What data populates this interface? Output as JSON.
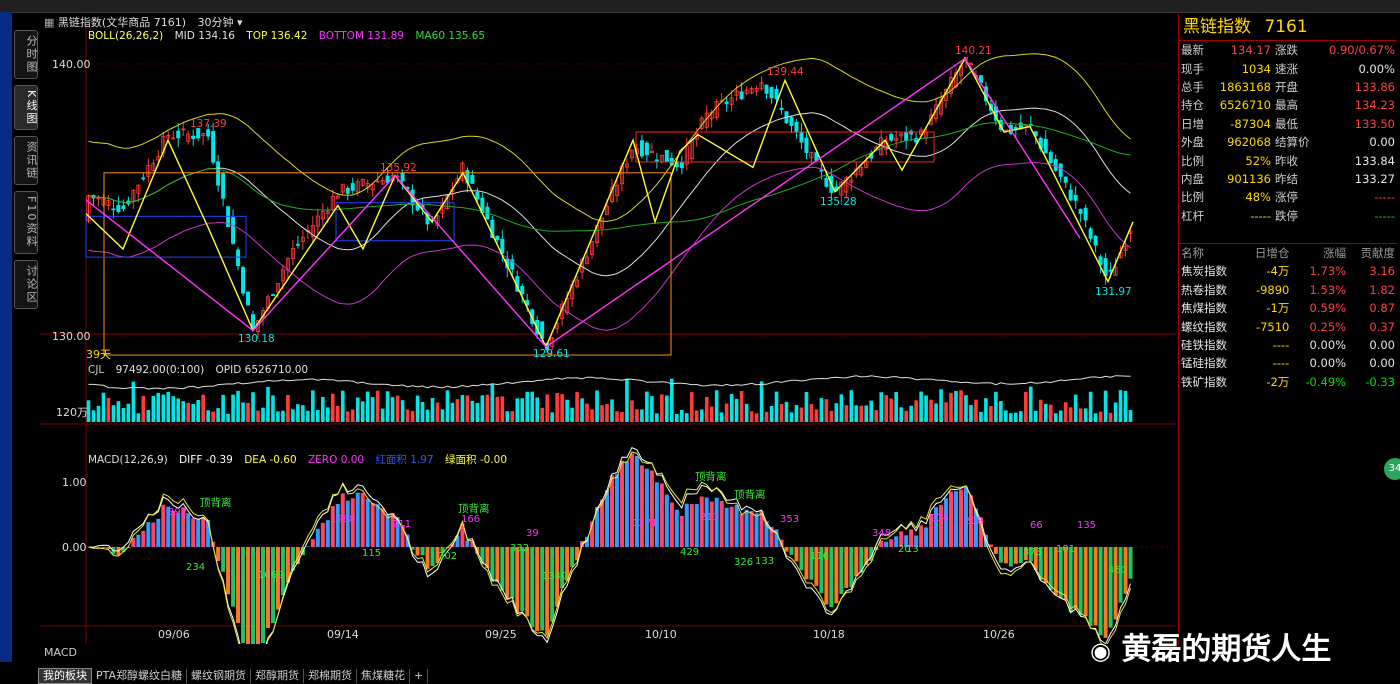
{
  "left_tabs": [
    "分时图",
    "K线图",
    "资讯链",
    "F10资料",
    "讨论区"
  ],
  "header": {
    "title": "黑链指数(文华商品 7161)",
    "period": "30分钟"
  },
  "boll": {
    "name": "BOLL(26,26,2)",
    "mid": "MID 134.16",
    "top": "TOP 136.42",
    "bottom": "BOTTOM 131.89",
    "ma60": "MA60 135.65"
  },
  "price_axis": [
    "140.00",
    "130.00"
  ],
  "days_label": "39天",
  "cjl": {
    "name": "CJL",
    "value": "97492.00(0:100)",
    "opid": "OPID 6526710.00",
    "axis": "120万"
  },
  "macd": {
    "name": "MACD(12,26,9)",
    "diff": "DIFF -0.39",
    "dea": "DEA -0.60",
    "zero": "ZERO 0.00",
    "red_area": "红面积 1.97",
    "green_area": "绿面积 -0.00",
    "axis": [
      "1.00",
      "0.00"
    ]
  },
  "dates": [
    "09/06",
    "09/14",
    "09/25",
    "10/10",
    "10/18",
    "10/26"
  ],
  "price_labels": [
    "137.39",
    "135.92",
    "139.44",
    "140.21",
    "130.18",
    "129.61",
    "135.28",
    "131.97"
  ],
  "macd_labels": [
    "392",
    "1968",
    "211",
    "166",
    "39",
    "1271",
    "211",
    "353",
    "348",
    "274",
    "208",
    "66",
    "135",
    "234",
    "1069",
    "115",
    "302",
    "332",
    "1340",
    "429",
    "326",
    "133",
    "116",
    "20",
    "13",
    "373",
    "101",
    "460"
  ],
  "divergence_labels": [
    "顶背离",
    "顶背离",
    "顶背离",
    "顶背离"
  ],
  "quote": {
    "title_name": "黑链指数",
    "title_code": "7161",
    "rows": [
      [
        "最新",
        "134.17",
        "r",
        "涨跌",
        "0.90/0.67%",
        "r"
      ],
      [
        "现手",
        "1034",
        "y",
        "速涨",
        "0.00%",
        "w"
      ],
      [
        "总手",
        "1863168",
        "y",
        "开盘",
        "133.86",
        "r"
      ],
      [
        "持仓",
        "6526710",
        "y",
        "最高",
        "134.23",
        "r"
      ],
      [
        "日增",
        "-87304",
        "y",
        "最低",
        "133.50",
        "r"
      ],
      [
        "外盘",
        "962068",
        "y",
        "结算价",
        "0.00",
        "w"
      ],
      [
        "比例",
        "52%",
        "y",
        "昨收",
        "133.84",
        "w"
      ],
      [
        "内盘",
        "901136",
        "y",
        "昨结",
        "133.27",
        "w"
      ],
      [
        "比例",
        "48%",
        "y",
        "涨停",
        "-----",
        "r"
      ],
      [
        "杠杆",
        "-----",
        "y",
        "跌停",
        "-----",
        "g"
      ]
    ],
    "related_head": [
      "名称",
      "日增仓",
      "涨幅",
      "贡献度"
    ],
    "related": [
      [
        "焦炭指数",
        "-4万",
        "1.73%",
        "3.16",
        "r"
      ],
      [
        "热卷指数",
        "-9890",
        "1.53%",
        "1.82",
        "r"
      ],
      [
        "焦煤指数",
        "-1万",
        "0.59%",
        "0.87",
        "r"
      ],
      [
        "螺纹指数",
        "-7510",
        "0.25%",
        "0.37",
        "r"
      ],
      [
        "硅铁指数",
        "----",
        "0.00%",
        "0.00",
        "w"
      ],
      [
        "锰硅指数",
        "----",
        "0.00%",
        "0.00",
        "w"
      ],
      [
        "铁矿指数",
        "-2万",
        "-0.49%",
        "-0.33",
        "g"
      ]
    ]
  },
  "bottom_tabs": [
    "我的板块",
    "PTA郑醇螺纹白糖",
    "螺纹钢期货",
    "郑醇期货",
    "郑棉期货",
    "焦煤糖花",
    "+"
  ],
  "macd_tab": "MACD",
  "watermark": "黄磊的期货人生",
  "badge": "34",
  "colors": {
    "up": "#ff3b3b",
    "down": "#00e5e5",
    "macd_up": "#ff4466",
    "macd_down": "#22c266",
    "zigzag": "#ffff33",
    "trend": "#ff33ff",
    "box": "#ff8c1a"
  }
}
